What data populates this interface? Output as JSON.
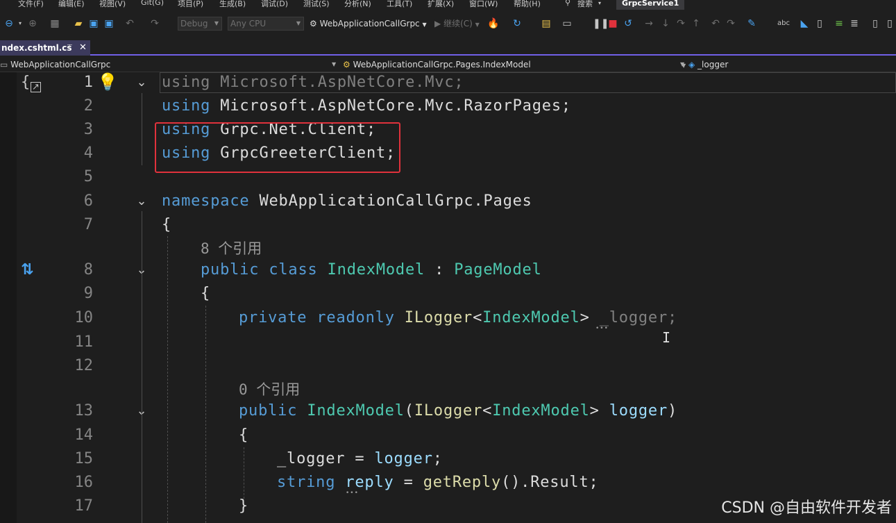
{
  "menu": {
    "items": [
      "文件(F)",
      "编辑(E)",
      "视图(V)",
      "Git(G)",
      "项目(P)",
      "生成(B)",
      "调试(D)",
      "测试(S)",
      "分析(N)",
      "工具(T)",
      "扩展(X)",
      "窗口(W)",
      "帮助(H)"
    ],
    "search_label": "搜索",
    "solution_title": "GrpcService1"
  },
  "toolbar": {
    "config_combo": "Debug",
    "platform_combo": "Any CPU",
    "startup_project": "WebApplicationCallGrpc",
    "continue_label": "继续(C)"
  },
  "tab": {
    "file_name": "ndex.cshtml.cs"
  },
  "navbar": {
    "project": "WebApplicationCallGrpc",
    "type": "WebApplicationCallGrpc.Pages.IndexModel",
    "member": "_logger"
  },
  "editor": {
    "line_numbers": [
      "1",
      "2",
      "3",
      "4",
      "5",
      "6",
      "7",
      "8",
      "9",
      "10",
      "11",
      "12",
      "13",
      "14",
      "15",
      "16",
      "17"
    ],
    "codelens": [
      "8 个引用",
      "0 个引用"
    ],
    "lines": {
      "l1_kw": "using",
      "l1_ns": " Microsoft.AspNetCore.Mvc;",
      "l2_kw": "using",
      "l2_ns": " Microsoft.AspNetCore.Mvc.RazorPages;",
      "l3_kw": "using",
      "l3_ns": " Grpc.Net.Client;",
      "l4_kw": "using",
      "l4_ns": " GrpcGreeterClient;",
      "l6_kw": "namespace",
      "l6_ns": " WebApplicationCallGrpc.Pages",
      "l7": "{",
      "l8_public": "public",
      "l8_class": " class ",
      "l8_name": "IndexModel",
      "l8_colon": " : ",
      "l8_base": "PageModel",
      "l9": "{",
      "l10_private": "private",
      "l10_readonly": " readonly ",
      "l10_type": "ILogger",
      "l10_lt": "<",
      "l10_targ": "IndexModel",
      "l10_gt": "> ",
      "l10_field": "_logger",
      "l10_semi": ";",
      "l13_public": "public",
      "l13_name": " IndexModel",
      "l13_paren": "(",
      "l13_type": "ILogger",
      "l13_lt": "<",
      "l13_targ": "IndexModel",
      "l13_gt": "> ",
      "l13_param": "logger",
      "l13_close": ")",
      "l14": "{",
      "l15_field": "_logger",
      "l15_eq": " = ",
      "l15_param": "logger",
      "l15_semi": ";",
      "l16_kw": "string",
      "l16_var": " reply",
      "l16_eq": " = ",
      "l16_fn": "getReply",
      "l16_rest": "().Result;",
      "l17": "}"
    }
  },
  "watermark": "CSDN @自由软件开发者"
}
